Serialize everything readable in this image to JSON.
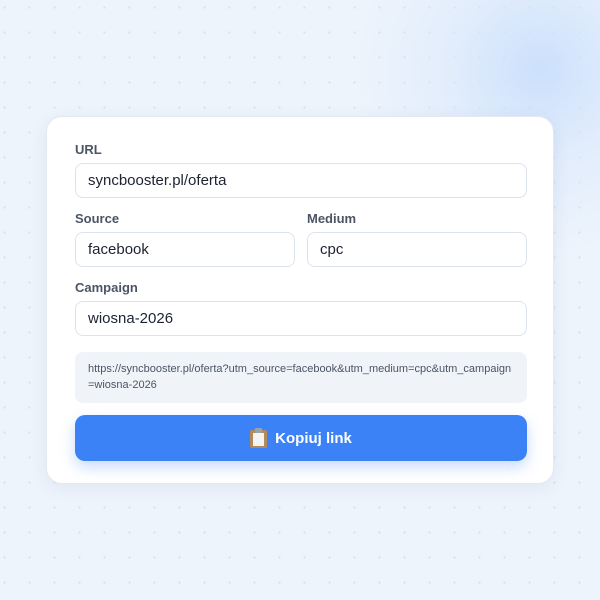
{
  "form": {
    "url": {
      "label": "URL",
      "value": "syncbooster.pl/oferta"
    },
    "source": {
      "label": "Source",
      "value": "facebook"
    },
    "medium": {
      "label": "Medium",
      "value": "cpc"
    },
    "campaign": {
      "label": "Campaign",
      "value": "wiosna-2026"
    }
  },
  "result": {
    "generated_url": "https://syncbooster.pl/oferta?utm_source=facebook&utm_medium=cpc&utm_campaign=wiosna-2026"
  },
  "copy_button": {
    "label": "Kopiuj link",
    "icon": "clipboard-icon"
  },
  "colors": {
    "accent": "#3b82f6",
    "background": "#eef4fc",
    "card": "#ffffff"
  }
}
